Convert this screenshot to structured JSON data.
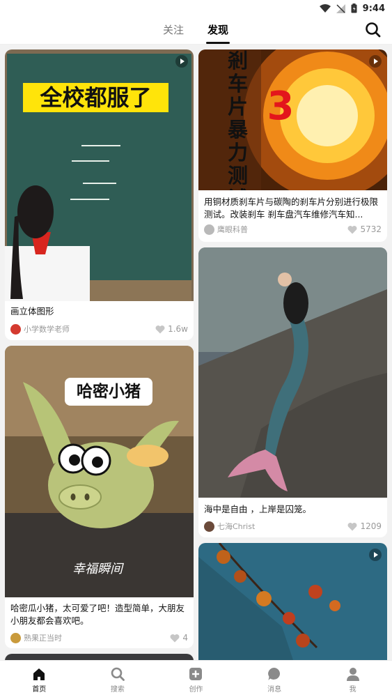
{
  "status_bar": {
    "time": "9:44"
  },
  "top_nav": {
    "tabs": [
      {
        "label": "关注"
      },
      {
        "label": "发现"
      }
    ],
    "active_tab": "发现"
  },
  "feed": {
    "cards": [
      {
        "overlay_text": "全校都服了",
        "title": "画立体图形",
        "author": "小学数学老师",
        "likes": "1.6w",
        "has_video": true
      },
      {
        "overlay_text": "剎车片暴力测试",
        "overlay_number": "3",
        "title": "用铜材质刹车片与碳陶的刹车片分别进行极限测试。改装刹车 刹车盘汽车维修汽车知...",
        "author": "鹰眼科普",
        "likes": "5732",
        "has_video": true
      },
      {
        "overlay_text": "哈密小猪",
        "watermark": "幸福瞬间",
        "title": "哈密瓜小猪，太可爱了吧！造型简单，大朋友小朋友都会喜欢吧。",
        "author": "熟果正当时",
        "likes": "4",
        "has_video": false
      },
      {
        "title": "海中是自由 ，上岸是囚笼。",
        "author": "七海Christ",
        "likes": "1209",
        "has_video": false
      },
      {
        "has_video": true
      }
    ]
  },
  "bottom_nav": {
    "items": [
      {
        "label": "首页",
        "icon": "home-icon"
      },
      {
        "label": "搜索",
        "icon": "search-icon"
      },
      {
        "label": "创作",
        "icon": "create-icon"
      },
      {
        "label": "消息",
        "icon": "message-icon"
      },
      {
        "label": "我",
        "icon": "profile-icon"
      }
    ],
    "active": "首页"
  },
  "colors": {
    "accent": "#111111",
    "muted": "#999999",
    "background": "#f2f2f2"
  }
}
